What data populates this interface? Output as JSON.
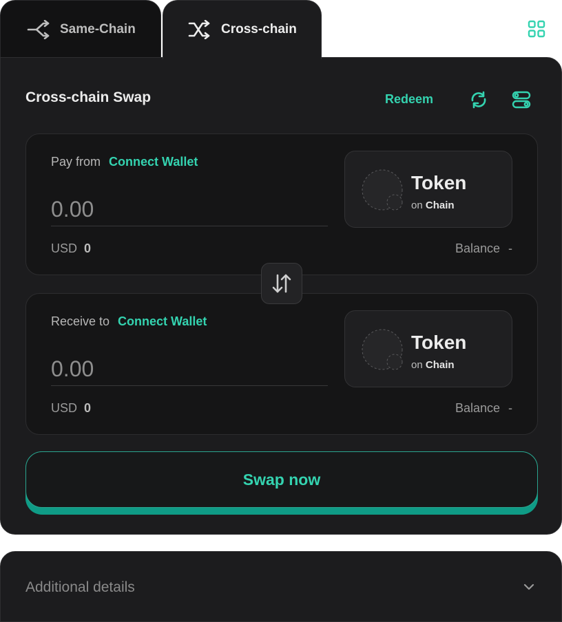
{
  "tabs": [
    {
      "label": "Same-Chain",
      "icon": "split-arrows-icon",
      "active": false
    },
    {
      "label": "Cross-chain",
      "icon": "shuffle-icon",
      "active": true
    }
  ],
  "header": {
    "menu_icon": "grid-icon"
  },
  "card": {
    "title": "Cross-chain Swap",
    "redeem_label": "Redeem",
    "refresh_icon": "refresh-icon",
    "settings_icon": "settings-toggle-icon"
  },
  "pay": {
    "label": "Pay from",
    "connect_label": "Connect Wallet",
    "amount_placeholder": "0.00",
    "usd_label": "USD",
    "usd_value": "0",
    "balance_label": "Balance",
    "balance_value": "-",
    "token_name": "Token",
    "token_on": "on",
    "token_chain": "Chain"
  },
  "receive": {
    "label": "Receive to",
    "connect_label": "Connect Wallet",
    "amount_placeholder": "0.00",
    "usd_label": "USD",
    "usd_value": "0",
    "balance_label": "Balance",
    "balance_value": "-",
    "token_name": "Token",
    "token_on": "on",
    "token_chain": "Chain"
  },
  "swap_direction_icon": "swap-vertical-arrows-icon",
  "swap_button_label": "Swap now",
  "details": {
    "label": "Additional details",
    "icon": "chevron-down-icon"
  },
  "colors": {
    "accent": "#34d3b0",
    "accent_shadow": "#0f9b86",
    "card_bg": "#1c1c1e",
    "panel_bg": "#151516"
  }
}
